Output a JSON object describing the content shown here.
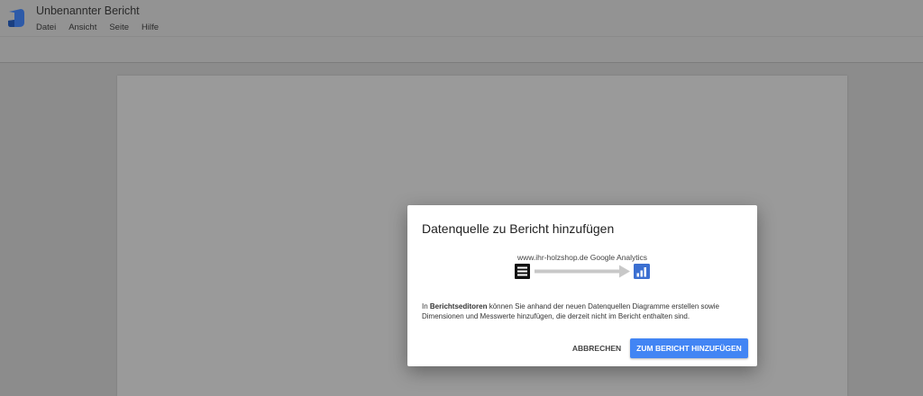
{
  "app": {
    "logo_icon": "data-studio-logo-icon",
    "report_title": "Unbenannter Bericht",
    "menu": [
      "Datei",
      "Ansicht",
      "Seite",
      "Hilfe"
    ]
  },
  "dialog": {
    "title": "Datenquelle zu Bericht hinzufügen",
    "datasource_name": "www.ihr-holzshop.de Google Analytics",
    "source_icon": "database-table-icon",
    "arrow_icon": "arrow-right-icon",
    "target_icon": "report-chart-icon",
    "description_prefix": "In ",
    "description_bold": "Berichtseditoren",
    "description_rest": " können Sie anhand der neuen Datenquellen Diagramme erstellen sowie Dimensionen und Messwerte hinzufügen, die derzeit nicht im Bericht enthalten sind.",
    "cancel_label": "ABBRECHEN",
    "confirm_label": "ZUM BERICHT HINZUFÜGEN"
  },
  "colors": {
    "accent": "#4285f4",
    "overlay_bg": "#8e8e8e",
    "logo_dark": "#1a57a8"
  }
}
